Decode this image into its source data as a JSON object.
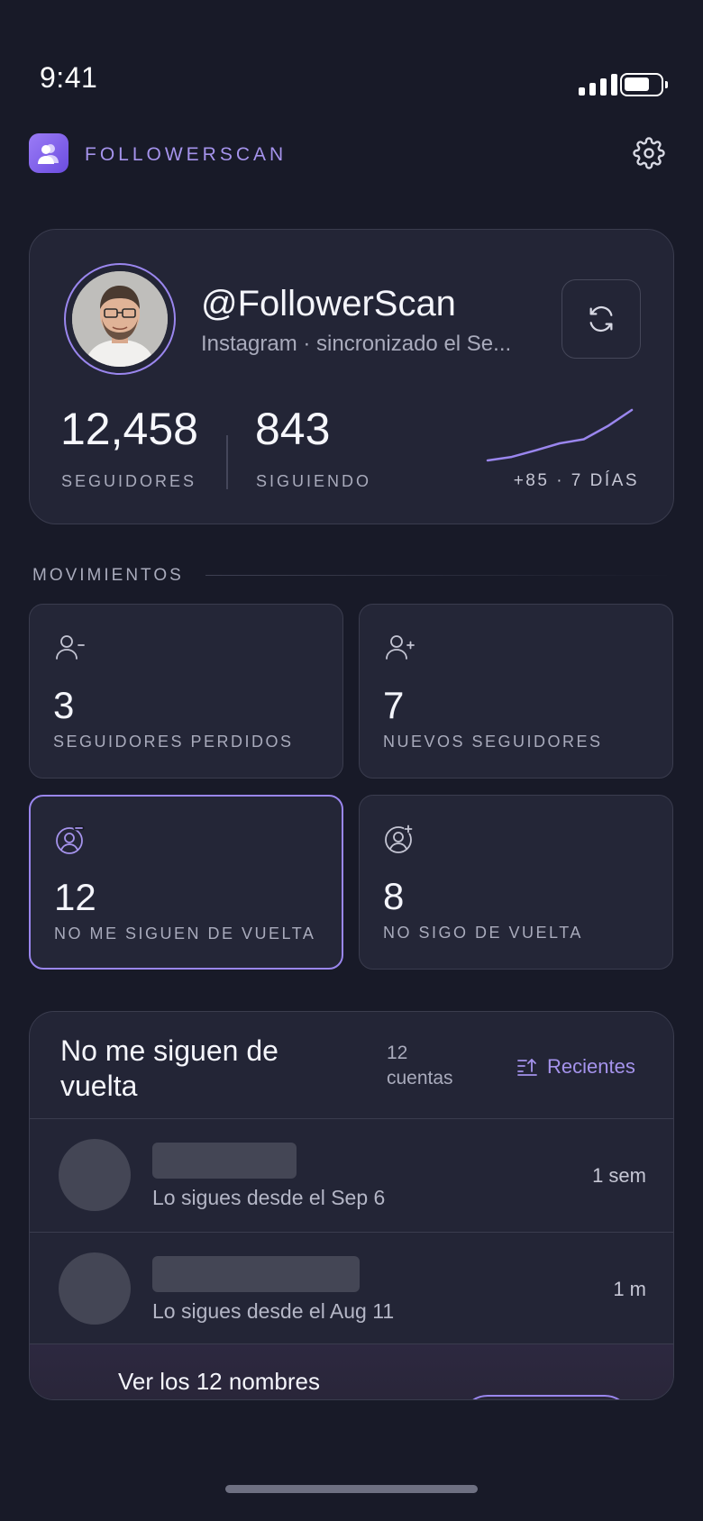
{
  "status_bar": {
    "time": "9:41"
  },
  "header": {
    "brand": "FOLLOWERSCAN"
  },
  "profile": {
    "handle": "@FollowerScan",
    "sync_text": "Instagram · sincronizado el Se...",
    "followers_value": "12,458",
    "followers_label": "SEGUIDORES",
    "following_value": "843",
    "following_label": "SIGUIENDO",
    "trend_text": "+85 · 7 DÍAS",
    "trend_points": [
      0,
      0.07,
      0.2,
      0.34,
      0.42,
      0.68,
      1.0
    ]
  },
  "movements": {
    "section_title": "MOVIMIENTOS",
    "cards": [
      {
        "icon": "user-minus-icon",
        "value": "3",
        "label": "SEGUIDORES PERDIDOS",
        "active": false
      },
      {
        "icon": "user-plus-icon",
        "value": "7",
        "label": "NUEVOS SEGUIDORES",
        "active": false
      },
      {
        "icon": "user-circle-minus-icon",
        "value": "12",
        "label": "NO ME SIGUEN DE VUELTA",
        "active": true
      },
      {
        "icon": "user-circle-plus-icon",
        "value": "8",
        "label": "NO SIGO DE VUELTA",
        "active": false
      }
    ]
  },
  "list": {
    "title": "No me siguen de vuelta",
    "count": "12 cuentas",
    "sort_label": "Recientes",
    "rows": [
      {
        "since": "Lo sigues desde el Sep 6",
        "ago": "1 sem"
      },
      {
        "since": "Lo sigues desde el Aug 11",
        "ago": "1 m"
      }
    ],
    "cta_text": "Ver los 12 nombres"
  },
  "colors": {
    "background": "#181a28",
    "card": "#232536",
    "accent": "#9a86ee",
    "muted_text": "#a9abbc"
  }
}
